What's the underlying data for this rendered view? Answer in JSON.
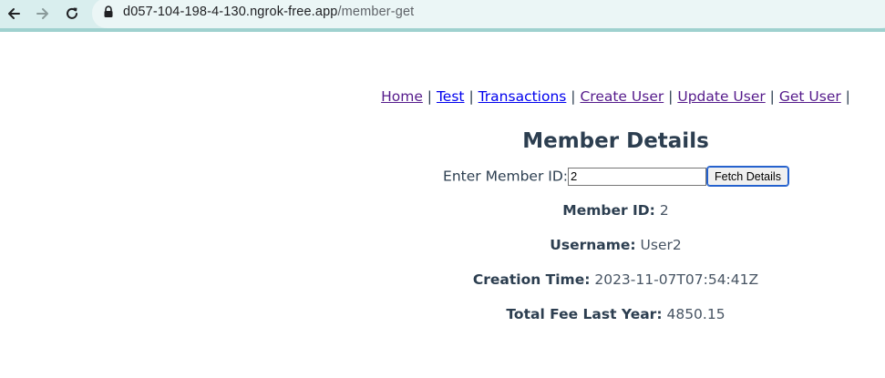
{
  "browser": {
    "url_host": "d057-104-198-4-130.ngrok-free.app",
    "url_path": "/member-get"
  },
  "nav": {
    "links": [
      "Home",
      "Test",
      "Transactions",
      "Create User",
      "Update User",
      "Get User"
    ],
    "separator": "|"
  },
  "page": {
    "title": "Member Details"
  },
  "form": {
    "label": "Enter Member ID:",
    "input_value": "2",
    "button_label": "Fetch Details"
  },
  "details": [
    {
      "label": "Member ID:",
      "value": "2"
    },
    {
      "label": "Username:",
      "value": "User2"
    },
    {
      "label": "Creation Time:",
      "value": "2023-11-07T07:54:41Z"
    },
    {
      "label": "Total Fee Last Year:",
      "value": "4850.15"
    }
  ],
  "colors": {
    "text": "#2c3e50",
    "link_visited": "#551a8b",
    "link_unvisited": "#0000ee",
    "toolbar": "#d9eeee"
  },
  "icons": [
    "back-arrow-icon",
    "forward-arrow-icon",
    "reload-icon",
    "lock-icon"
  ]
}
